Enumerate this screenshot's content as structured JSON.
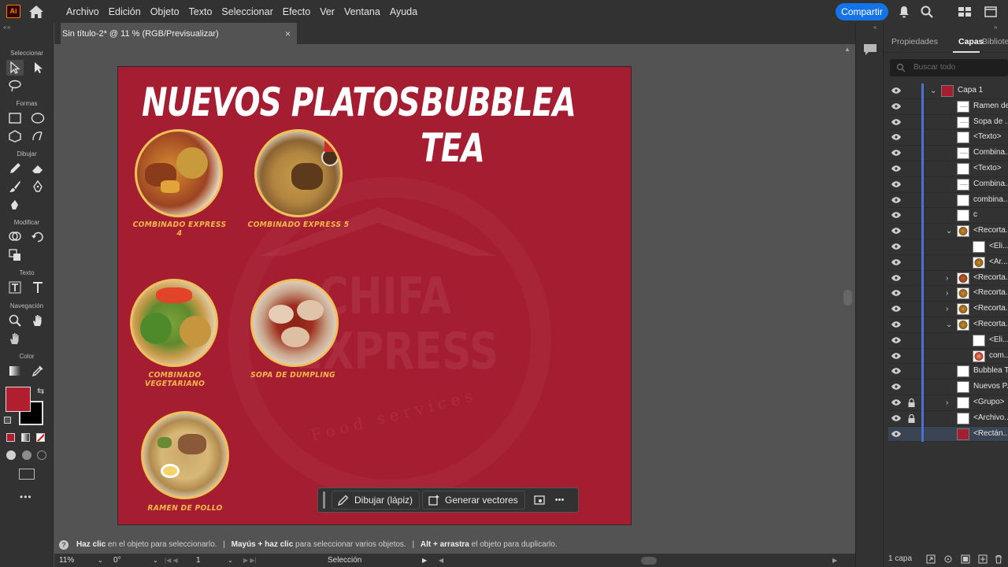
{
  "app": {
    "logo": "Ai",
    "menu": [
      "Archivo",
      "Edición",
      "Objeto",
      "Texto",
      "Seleccionar",
      "Efecto",
      "Ver",
      "Ventana",
      "Ayuda"
    ],
    "share_label": "Compartir"
  },
  "tools": {
    "sections": {
      "seleccionar": "Seleccionar",
      "formas": "Formas",
      "dibujar": "Dibujar",
      "modificar": "Modificar",
      "texto": "Texto",
      "navegacion": "Navegación",
      "color": "Color"
    },
    "fill_color": "#b01e2f",
    "stroke_color": "#000000"
  },
  "document": {
    "tab_title": "Sin título-2* @ 11 % (RGB/Previsualizar)",
    "close": "×"
  },
  "artboard": {
    "background": "#a51d30",
    "heading_left": "NUEVOS PLATOS",
    "heading_right": "BUBBLEA TEA",
    "watermark": {
      "line1": "CHIFA",
      "line2": "EXPRESS",
      "line3": "Food services"
    },
    "items": [
      {
        "caption": "COMBINADO EXPRESS 4"
      },
      {
        "caption": "COMBINADO EXPRESS 5"
      },
      {
        "caption": "COMBINADO VEGETARIANO"
      },
      {
        "caption": "SOPA DE DUMPLING"
      },
      {
        "caption": "RAMEN DE POLLO"
      }
    ]
  },
  "floating_bar": {
    "draw_label": "Dibujar (lápiz)",
    "vectors_label": "Generar vectores",
    "more": "•••"
  },
  "status": {
    "hint_1_bold": "Haz clic",
    "hint_1": " en el objeto para seleccionarlo.",
    "sep": "|",
    "hint_2_bold": "Mayús + haz clic",
    "hint_2": " para seleccionar varios objetos.",
    "hint_3_bold": "Alt + arrastra",
    "hint_3": " el objeto para duplicarlo.",
    "zoom": "11%",
    "rotation": "0°",
    "artboard_num": "1",
    "mode": "Selección"
  },
  "panel": {
    "tabs": [
      "Propiedades",
      "Capas",
      "Bibliote"
    ],
    "search_placeholder": "Buscar todo",
    "layers": [
      {
        "name": "Capa 1",
        "chev": "v",
        "indent": 0,
        "thumb": "red"
      },
      {
        "name": "Ramen de...",
        "chev": "",
        "indent": 1,
        "thumb": "white-line"
      },
      {
        "name": "Sopa de ...",
        "chev": "",
        "indent": 1,
        "thumb": "white-line"
      },
      {
        "name": "<Texto>",
        "chev": "",
        "indent": 1,
        "thumb": "white"
      },
      {
        "name": "Combina...",
        "chev": "",
        "indent": 1,
        "thumb": "white-line"
      },
      {
        "name": "<Texto>",
        "chev": "",
        "indent": 1,
        "thumb": "white"
      },
      {
        "name": "Combina...",
        "chev": "",
        "indent": 1,
        "thumb": "white-line"
      },
      {
        "name": "combina...",
        "chev": "",
        "indent": 1,
        "thumb": "white"
      },
      {
        "name": "c",
        "chev": "",
        "indent": 1,
        "thumb": "white"
      },
      {
        "name": "<Recorta...",
        "chev": "v",
        "indent": 1,
        "thumb": "food"
      },
      {
        "name": "<Eli...",
        "chev": "",
        "indent": 2,
        "thumb": "white"
      },
      {
        "name": "<Ar...",
        "chev": "",
        "indent": 2,
        "thumb": "food"
      },
      {
        "name": "<Recorta...",
        "chev": ">",
        "indent": 1,
        "thumb": "food2"
      },
      {
        "name": "<Recorta...",
        "chev": ">",
        "indent": 1,
        "thumb": "food"
      },
      {
        "name": "<Recorta...",
        "chev": ">",
        "indent": 1,
        "thumb": "food"
      },
      {
        "name": "<Recorta...",
        "chev": "v",
        "indent": 1,
        "thumb": "food"
      },
      {
        "name": "<Eli...",
        "chev": "",
        "indent": 2,
        "thumb": "white"
      },
      {
        "name": "com...",
        "chev": "",
        "indent": 2,
        "thumb": "food3"
      },
      {
        "name": "Bubblea T...",
        "chev": "",
        "indent": 1,
        "thumb": "white"
      },
      {
        "name": "Nuevos P...",
        "chev": "",
        "indent": 1,
        "thumb": "white"
      },
      {
        "name": "<Grupo>",
        "chev": ">",
        "indent": 1,
        "thumb": "white",
        "locked": true
      },
      {
        "name": "<Archivo...",
        "chev": "",
        "indent": 1,
        "thumb": "white",
        "locked": true
      },
      {
        "name": "<Rectán...",
        "chev": "",
        "indent": 1,
        "thumb": "red",
        "selected": true
      }
    ],
    "footer": "1 capa"
  }
}
